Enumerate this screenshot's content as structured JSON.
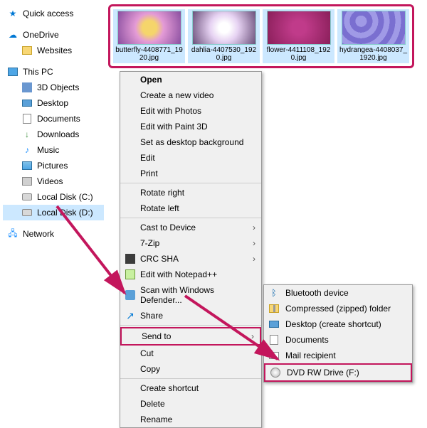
{
  "sidebar": {
    "quick_access": "Quick access",
    "onedrive": "OneDrive",
    "websites": "Websites",
    "this_pc": "This PC",
    "objects3d": "3D Objects",
    "desktop": "Desktop",
    "documents": "Documents",
    "downloads": "Downloads",
    "music": "Music",
    "pictures": "Pictures",
    "videos": "Videos",
    "disk_c": "Local Disk (C:)",
    "disk_d": "Local Disk (D:)",
    "network": "Network"
  },
  "thumbs": [
    {
      "label": "butterfly-4408771_1920.jpg"
    },
    {
      "label": "dahlia-4407530_1920.jpg"
    },
    {
      "label": "flower-4411108_1920.jpg"
    },
    {
      "label": "hydrangea-4408037_1920.jpg"
    }
  ],
  "menu": {
    "open": "Open",
    "create_video": "Create a new video",
    "edit_photos": "Edit with Photos",
    "edit_paint3d": "Edit with Paint 3D",
    "set_desktop": "Set as desktop background",
    "edit": "Edit",
    "print": "Print",
    "rotate_right": "Rotate right",
    "rotate_left": "Rotate left",
    "cast": "Cast to Device",
    "sevenzip": "7-Zip",
    "crc_sha": "CRC SHA",
    "edit_npp": "Edit with Notepad++",
    "scan_defender": "Scan with Windows Defender...",
    "share": "Share",
    "send_to": "Send to",
    "cut": "Cut",
    "copy": "Copy",
    "create_shortcut": "Create shortcut",
    "delete": "Delete",
    "rename": "Rename"
  },
  "submenu": {
    "bluetooth": "Bluetooth device",
    "compressed": "Compressed (zipped) folder",
    "desktop_shortcut": "Desktop (create shortcut)",
    "documents": "Documents",
    "mail": "Mail recipient",
    "dvd": "DVD RW Drive (F:)"
  },
  "highlight_color": "#c3165c"
}
